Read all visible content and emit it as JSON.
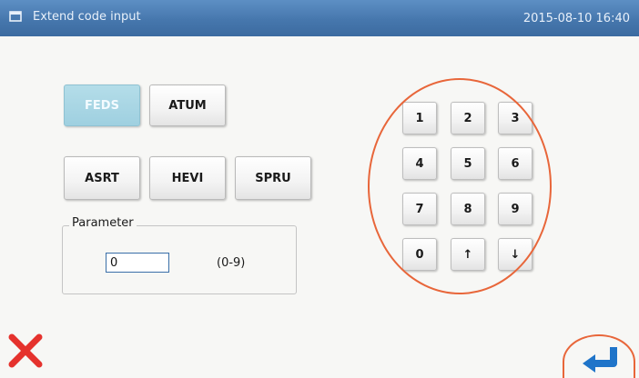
{
  "window": {
    "title": "Extend code input",
    "datetime": "2015-08-10 16:40"
  },
  "code_buttons": {
    "feds": "FEDS",
    "atum": "ATUM",
    "asrt": "ASRT",
    "hevi": "HEVI",
    "spru": "SPRU",
    "selected": "FEDS"
  },
  "parameter": {
    "label": "Parameter",
    "value": "0",
    "range": "(0-9)"
  },
  "keypad": {
    "keys": [
      "1",
      "2",
      "3",
      "4",
      "5",
      "6",
      "7",
      "8",
      "9",
      "0",
      "↑",
      "↓"
    ]
  },
  "icons": {
    "window": "window-icon",
    "cancel": "close-icon",
    "confirm": "enter-icon"
  },
  "colors": {
    "titlebar": "#4677ad",
    "selected_button": "#9fd0e0",
    "highlight_circle": "#e8663a",
    "cancel_red": "#e5322d",
    "enter_blue": "#1f74c9"
  }
}
